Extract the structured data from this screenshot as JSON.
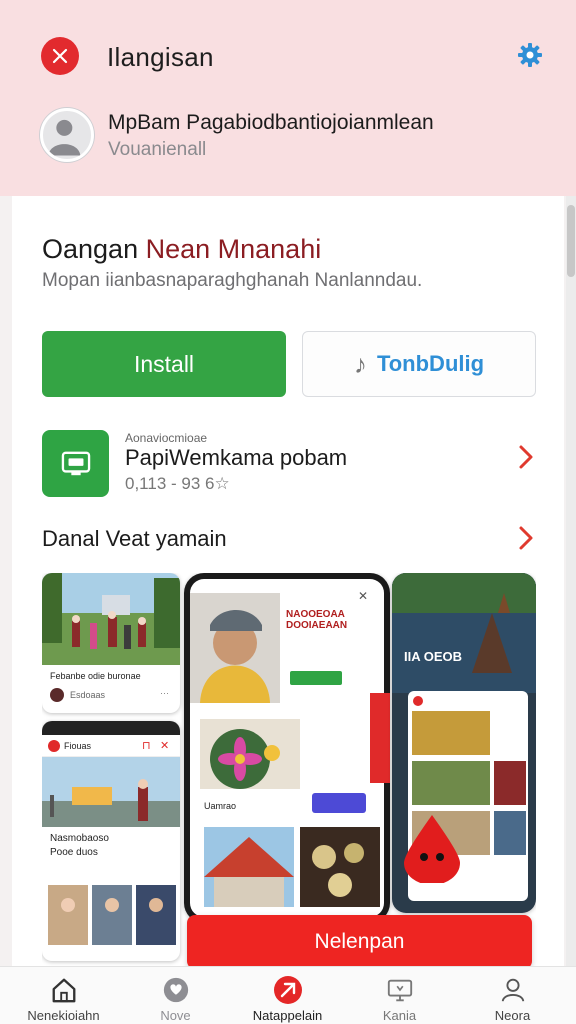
{
  "header": {
    "title": "Ilangisan",
    "account_name": "MpBam Pagabiodbantiojoianmlean",
    "account_sub": "Vouanienall"
  },
  "app": {
    "title_part1": "Oangan ",
    "title_part2": "Nean Mnanahi",
    "description": "Mopan iianbasnaparaghghanah Nanlanndau.",
    "install_label": "Install",
    "secondary_label": "TonbDulig"
  },
  "app_row": {
    "overline": "Aonaviocmioae",
    "name": "PapiWemkama pobam",
    "meta": "0,113 - 93 6☆"
  },
  "section": {
    "title": "Danal Veat yamain"
  },
  "screenshots": {
    "s1_caption": "Febanbe odie buronae",
    "s1_sub": "Esdoaas",
    "s2_header": "Fiouas",
    "s2_caption": "Nasmobaoso",
    "s2_sub": "Pooe duos",
    "s3_headline": "NAOOEOAA\nDOOIAEAAN",
    "s3_button": "",
    "s3_label": "Uamrao",
    "s4_headline": "IIA OEOB"
  },
  "cta": {
    "label": "Nelenpan"
  },
  "nav": [
    {
      "label": "Nenekioiahn",
      "icon": "home-icon"
    },
    {
      "label": "Nove",
      "icon": "heart-icon"
    },
    {
      "label": "Natappelain",
      "icon": "apps-icon"
    },
    {
      "label": "Kania",
      "icon": "tv-icon"
    },
    {
      "label": "Neora",
      "icon": "person-icon"
    }
  ],
  "colors": {
    "header_bg": "#f9dfe1",
    "accent_red": "#e22a2e",
    "install_green": "#34a444",
    "link_blue": "#2f8fd6"
  }
}
